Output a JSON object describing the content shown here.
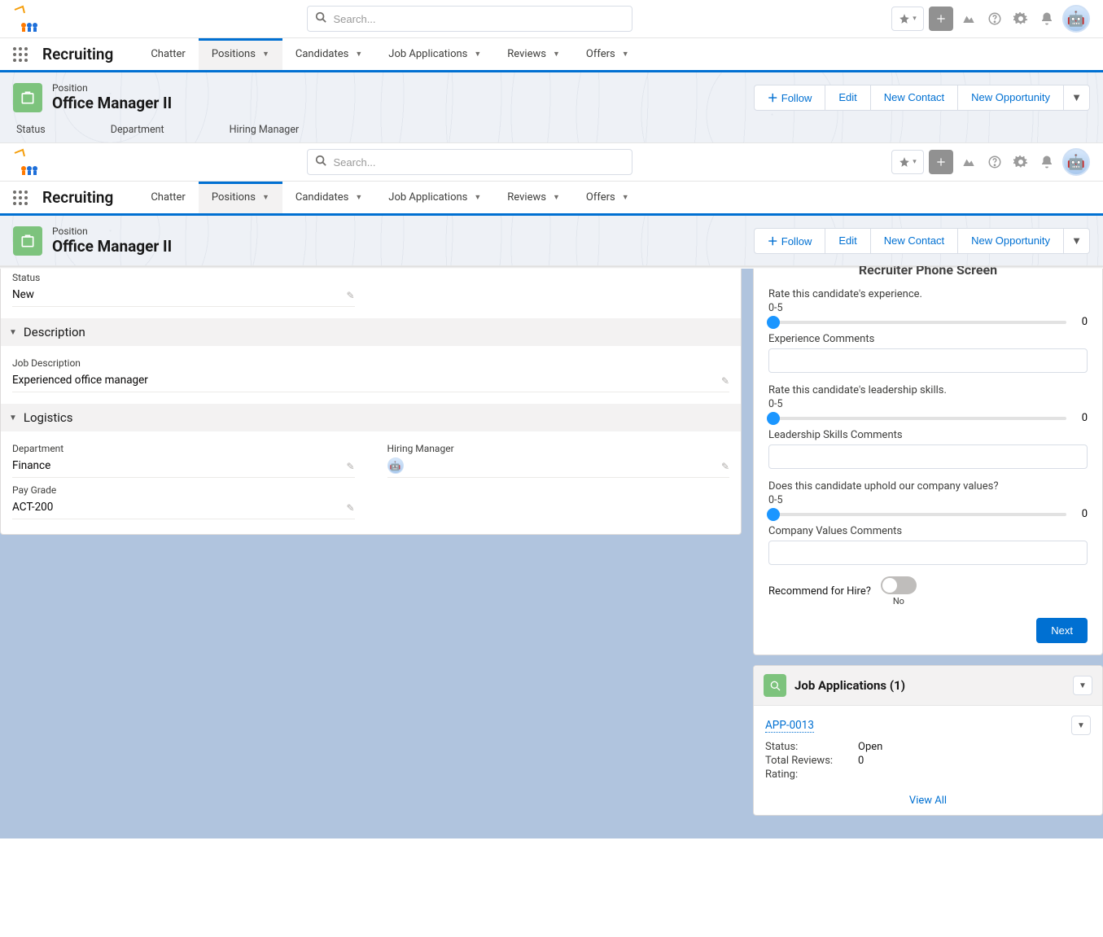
{
  "header": {
    "search_placeholder": "Search...",
    "icons": {
      "favorite": "star-dropdown-icon",
      "global_add": "plus-icon",
      "guidance": "trailhead-icon",
      "help": "question-icon",
      "setup": "gear-icon",
      "notifications": "bell-icon"
    }
  },
  "nav": {
    "app_name": "Recruiting",
    "tabs": [
      {
        "label": "Chatter",
        "active": false,
        "has_menu": false
      },
      {
        "label": "Positions",
        "active": true,
        "has_menu": true
      },
      {
        "label": "Candidates",
        "active": false,
        "has_menu": true
      },
      {
        "label": "Job Applications",
        "active": false,
        "has_menu": true
      },
      {
        "label": "Reviews",
        "active": false,
        "has_menu": true
      },
      {
        "label": "Offers",
        "active": false,
        "has_menu": true
      }
    ]
  },
  "page_header": {
    "object_label": "Position",
    "record_title": "Office Manager II",
    "actions": {
      "follow": "Follow",
      "edit": "Edit",
      "new_contact": "New Contact",
      "new_opportunity": "New Opportunity"
    },
    "highlights": [
      {
        "label": "Status"
      },
      {
        "label": "Department"
      },
      {
        "label": "Hiring Manager"
      }
    ]
  },
  "details": {
    "status_label": "Status",
    "status_value": "New",
    "sections": {
      "description": {
        "title": "Description",
        "job_description_label": "Job Description",
        "job_description_value": "Experienced office manager"
      },
      "logistics": {
        "title": "Logistics",
        "department_label": "Department",
        "department_value": "Finance",
        "hiring_manager_label": "Hiring Manager",
        "hiring_manager_value": "",
        "pay_grade_label": "Pay Grade",
        "pay_grade_value": "ACT-200"
      }
    }
  },
  "flow": {
    "header": "Recruiter Phone Screen",
    "range_label": "0-5",
    "questions": {
      "experience": {
        "prompt": "Rate this candidate's experience.",
        "value": "0",
        "comments_label": "Experience Comments"
      },
      "leadership": {
        "prompt": "Rate this candidate's leadership skills.",
        "value": "0",
        "comments_label": "Leadership Skills Comments"
      },
      "values": {
        "prompt": "Does this candidate uphold our company values?",
        "value": "0",
        "comments_label": "Company Values Comments"
      }
    },
    "recommend_label": "Recommend for Hire?",
    "recommend_value": "No",
    "next_label": "Next"
  },
  "related": {
    "title": "Job Applications (1)",
    "item": {
      "name": "APP-0013",
      "status_label": "Status:",
      "status_value": "Open",
      "total_reviews_label": "Total Reviews:",
      "total_reviews_value": "0",
      "rating_label": "Rating:",
      "rating_value": ""
    },
    "view_all": "View All"
  }
}
